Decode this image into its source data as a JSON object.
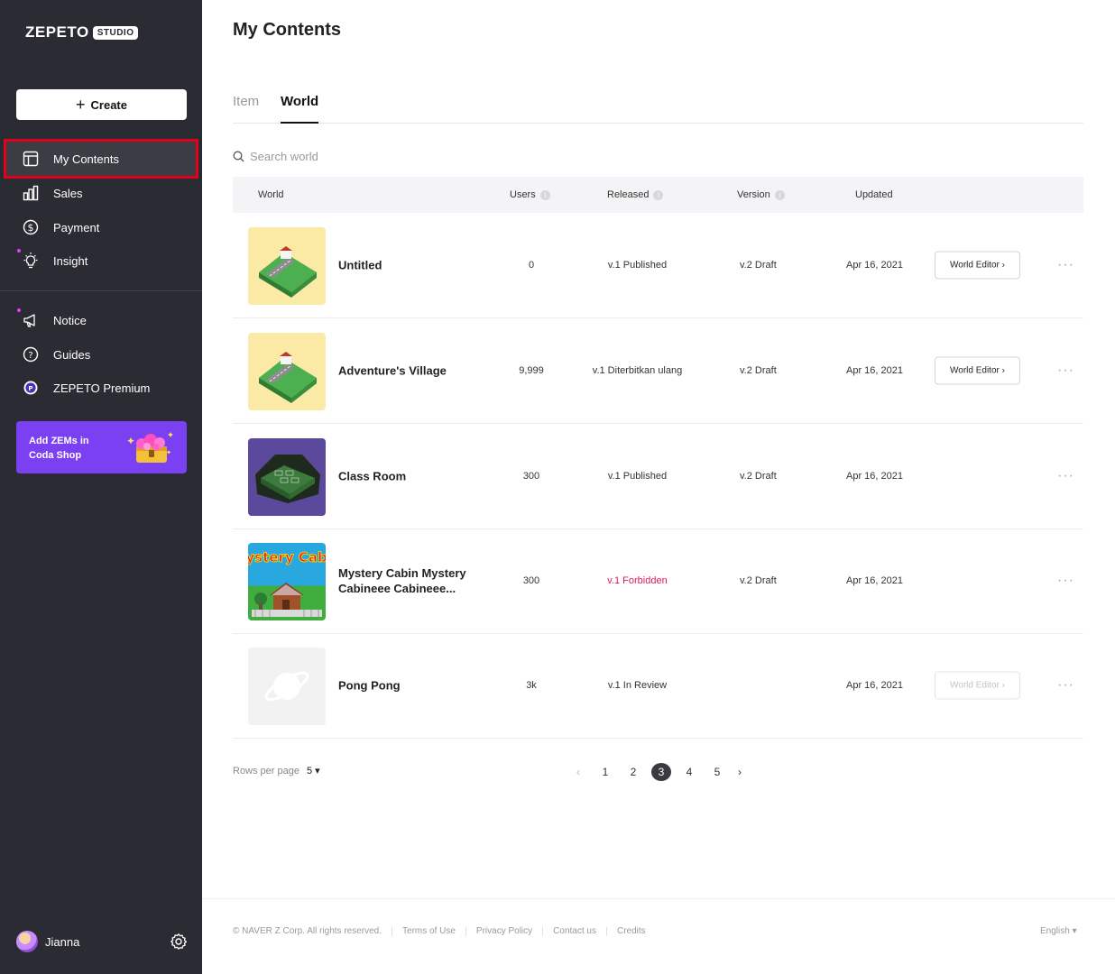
{
  "app": {
    "logo_word": "ZEPETO",
    "logo_badge": "STUDIO"
  },
  "sidebar": {
    "create_label": "Create",
    "items": [
      {
        "label": "My Contents",
        "icon": "layout-icon",
        "active": true
      },
      {
        "label": "Sales",
        "icon": "bar-chart-icon"
      },
      {
        "label": "Payment",
        "icon": "dollar-circle-icon"
      },
      {
        "label": "Insight",
        "icon": "lightbulb-icon",
        "dot": true
      },
      {
        "label": "Notice",
        "icon": "megaphone-icon",
        "dot": true
      },
      {
        "label": "Guides",
        "icon": "question-circle-icon"
      },
      {
        "label": "ZEPETO Premium",
        "icon": "premium-p-icon"
      }
    ],
    "promo": {
      "line1": "Add ZEMs in",
      "line2": "Coda Shop"
    },
    "user_name": "Jianna"
  },
  "main": {
    "title": "My Contents",
    "tabs": [
      {
        "label": "Item"
      },
      {
        "label": "World",
        "active": true
      }
    ],
    "search_placeholder": "Search world",
    "columns": {
      "world": "World",
      "users": "Users",
      "released": "Released",
      "version": "Version",
      "updated": "Updated"
    },
    "rows": [
      {
        "name": "Untitled",
        "users": "0",
        "released": "v.1  Published",
        "version": "v.2  Draft",
        "updated": "Apr 16, 2021",
        "button": "World Editor ›"
      },
      {
        "name": "Adventure's Village",
        "users": "9,999",
        "released": "v.1  Diterbitkan ulang",
        "version": "v.2  Draft",
        "updated": "Apr 16, 2021",
        "button": "World Editor ›"
      },
      {
        "name": "Class Room",
        "users": "300",
        "released": "v.1  Published",
        "version": "v.2  Draft",
        "updated": "Apr 16, 2021"
      },
      {
        "name": "Mystery Cabin Mystery Cabineee Cabineee...",
        "thumb_text": "Mystery Cabin",
        "users": "300",
        "released": "v.1  Forbidden",
        "version": "v.2  Draft",
        "updated": "Apr 16, 2021"
      },
      {
        "name": "Pong Pong",
        "users": "3k",
        "released": "v.1  In Review",
        "version": "",
        "updated": "Apr 16, 2021",
        "button": "World Editor ›",
        "button_disabled": true
      }
    ],
    "more_label": "···",
    "rows_per_page_label": "Rows per page",
    "rows_per_page_value": "5 ▾",
    "pagination": {
      "pages": [
        "1",
        "2",
        "3",
        "4",
        "5"
      ],
      "current": "3",
      "prev": "‹",
      "next": "›"
    }
  },
  "footer": {
    "links": [
      "© NAVER Z Corp. All rights reserved.",
      "Terms of Use",
      "Privacy Policy",
      "Contact us",
      "Credits"
    ],
    "language": "English ▾"
  },
  "colors": {
    "sidebar_bg": "#2b2b33",
    "promo_bg": "#7b40f2",
    "forbidden": "#e0185e",
    "highlight_border": "#e3001b"
  }
}
